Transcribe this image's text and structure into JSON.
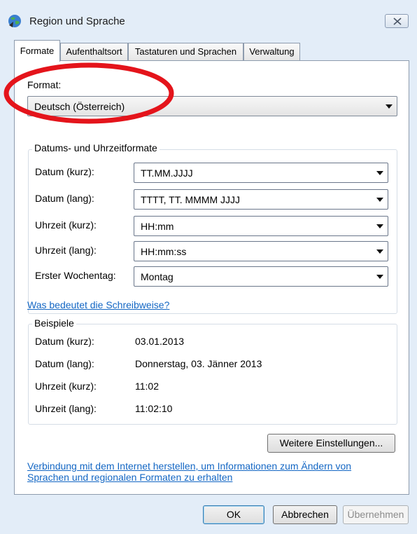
{
  "window": {
    "title": "Region und Sprache",
    "icon": "globe-icon"
  },
  "tabs": [
    {
      "label": "Formate",
      "active": true
    },
    {
      "label": "Aufenthaltsort",
      "active": false
    },
    {
      "label": "Tastaturen und Sprachen",
      "active": false
    },
    {
      "label": "Verwaltung",
      "active": false
    }
  ],
  "format": {
    "label": "Format:",
    "value": "Deutsch (Österreich)"
  },
  "datetime_formats": {
    "title": "Datums- und Uhrzeitformate",
    "rows": [
      {
        "label": "Datum (kurz):",
        "value": "TT.MM.JJJJ"
      },
      {
        "label": "Datum (lang):",
        "value": "TTTT, TT. MMMM JJJJ"
      },
      {
        "label": "Uhrzeit (kurz):",
        "value": "HH:mm"
      },
      {
        "label": "Uhrzeit (lang):",
        "value": "HH:mm:ss"
      },
      {
        "label": "Erster Wochentag:",
        "value": "Montag"
      }
    ],
    "help_link": "Was bedeutet die Schreibweise?"
  },
  "examples": {
    "title": "Beispiele",
    "rows": [
      {
        "label": "Datum (kurz):",
        "value": "03.01.2013"
      },
      {
        "label": "Datum (lang):",
        "value": "Donnerstag, 03. Jänner 2013"
      },
      {
        "label": "Uhrzeit (kurz):",
        "value": "11:02"
      },
      {
        "label": "Uhrzeit (lang):",
        "value": "11:02:10"
      }
    ]
  },
  "more_settings_label": "Weitere Einstellungen...",
  "internet_link_line1": "Verbindung mit dem Internet herstellen, um Informationen zum Ändern von",
  "internet_link_line2": "Sprachen und regionalen Formaten zu erhalten",
  "buttons": {
    "ok": "OK",
    "cancel": "Abbrechen",
    "apply": "Übernehmen"
  },
  "colors": {
    "link": "#1467c4",
    "highlight": "#e4141b",
    "window_frame": "#e3edf8"
  }
}
